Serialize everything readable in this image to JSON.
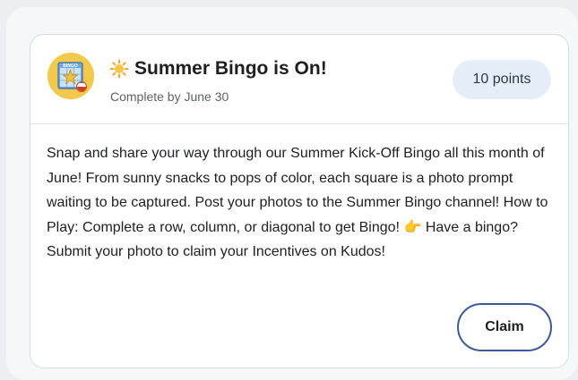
{
  "card": {
    "badge_label": "BINGO",
    "title": "Summer Bingo is On!",
    "subtitle": "Complete by June 30",
    "points": "10 points",
    "description": "Snap and share your way through our Summer Kick-Off Bingo all this month of June! From sunny snacks to pops of color, each square is a photo prompt waiting to be captured. Post your photos to the Summer Bingo channel! How to Play: Complete a row, column, or diagonal to get Bingo! 👉 Have a bingo? Submit your photo to claim your Incentives on Kudos!",
    "claim_label": "Claim"
  },
  "icons": {
    "title_emoji": "sun-icon",
    "badge": "bingo-card-badge"
  },
  "colors": {
    "points_bg": "#e5eef8",
    "claim_border": "#3c5a9a",
    "badge_bg": "#f2c94c"
  }
}
